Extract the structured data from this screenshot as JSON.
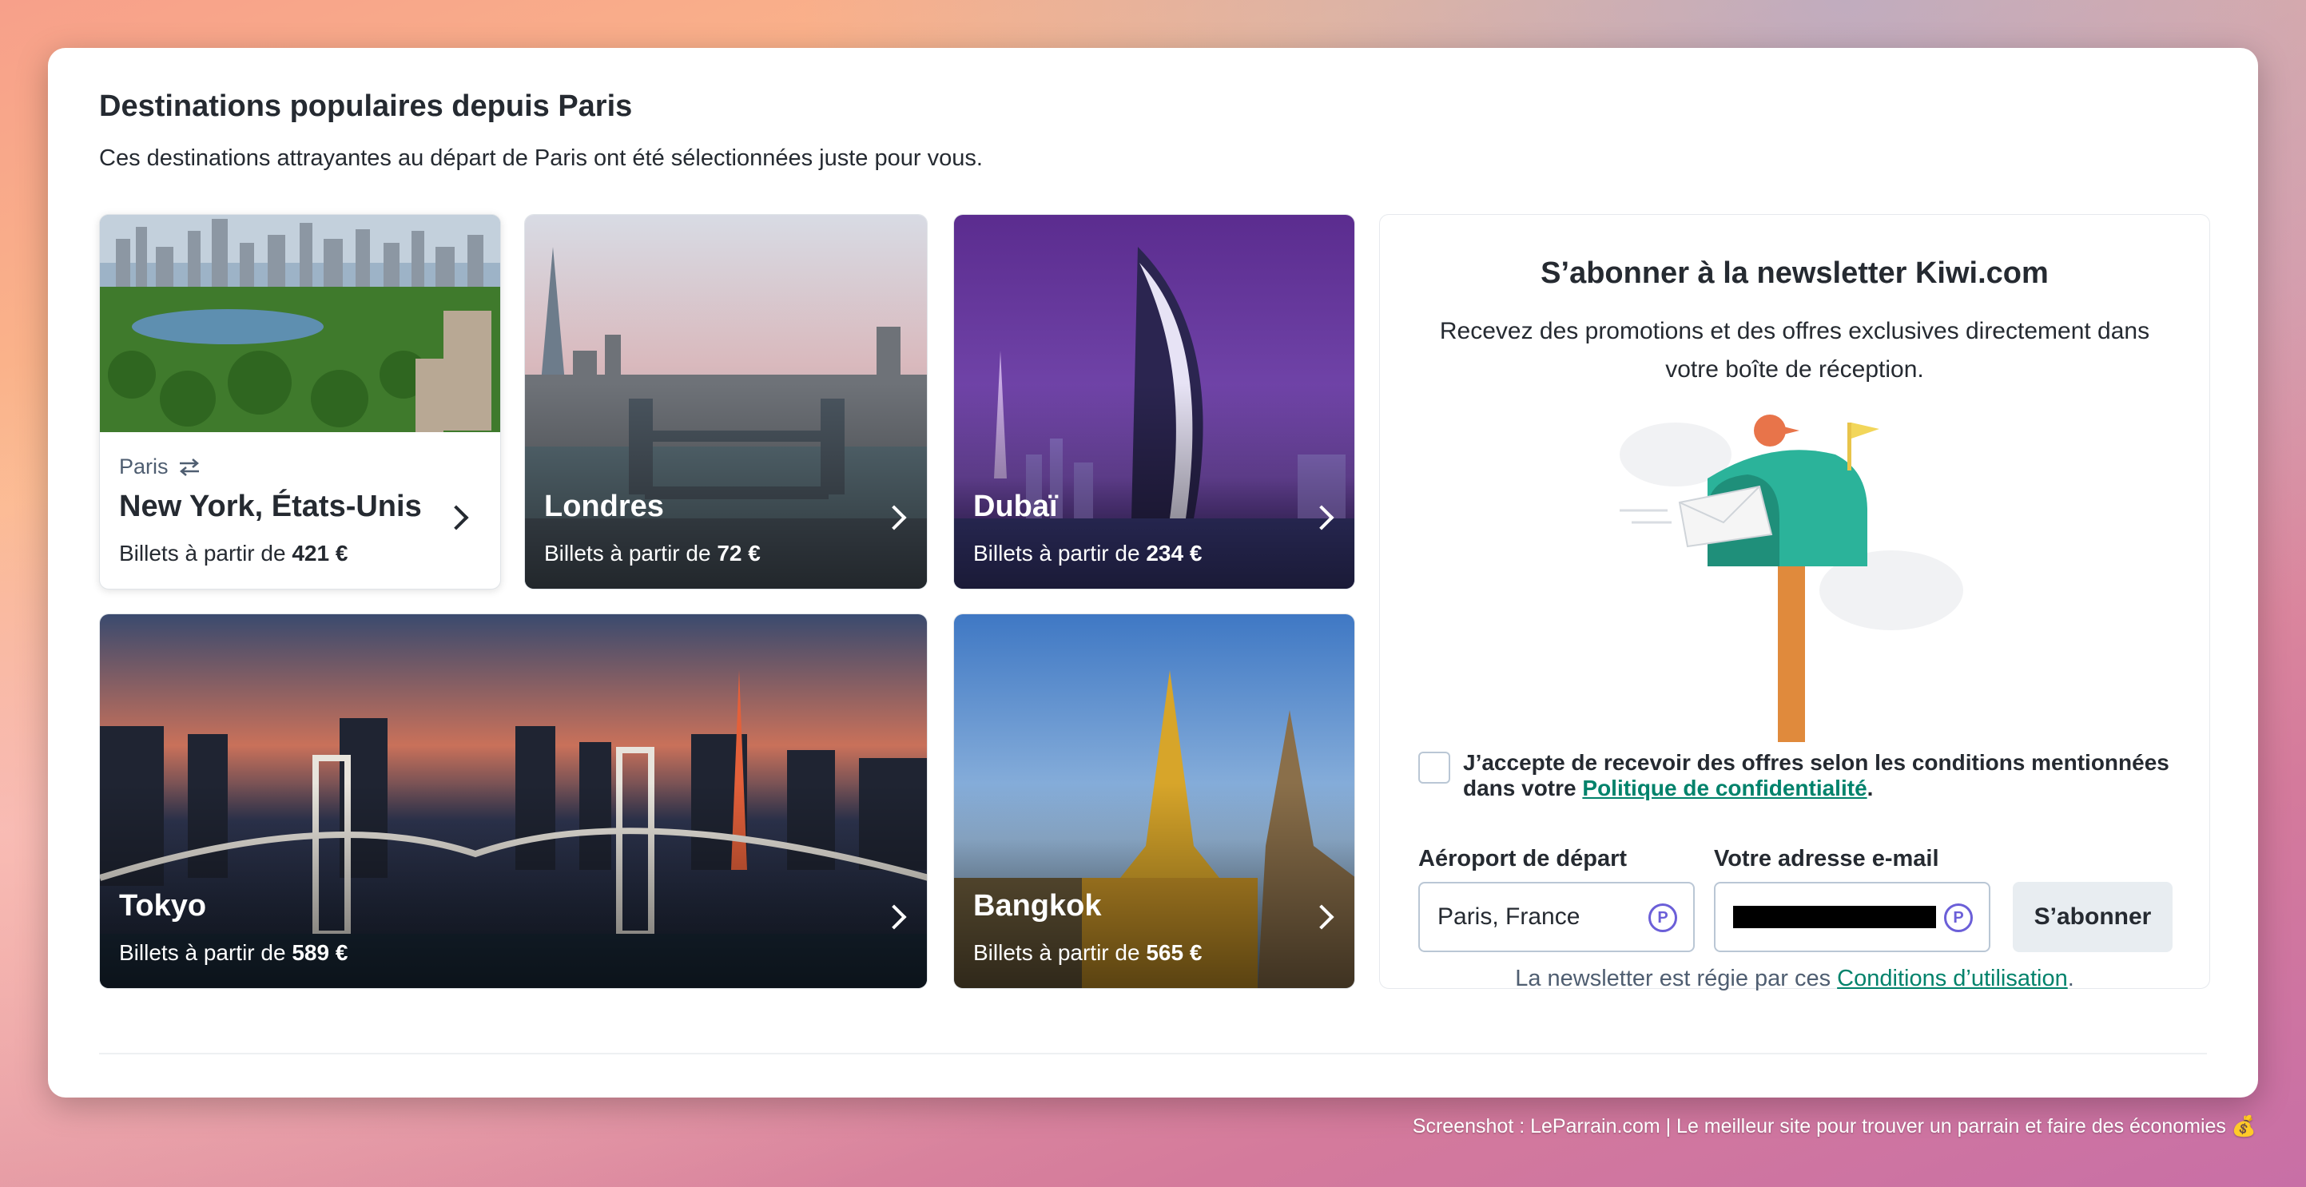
{
  "section": {
    "title": "Destinations populaires depuis Paris",
    "subtitle": "Ces destinations attrayantes au départ de Paris ont été sélectionnées juste pour vous."
  },
  "destinations": [
    {
      "origin": "Paris",
      "name": "New York, États-Unis",
      "price_prefix": "Billets à partir de ",
      "price": "421 €"
    },
    {
      "name": "Londres",
      "price_prefix": "Billets à partir de ",
      "price": "72 €"
    },
    {
      "name": "Dubaï",
      "price_prefix": "Billets à partir de ",
      "price": "234 €"
    },
    {
      "name": "Tokyo",
      "price_prefix": "Billets à partir de ",
      "price": "589 €"
    },
    {
      "name": "Bangkok",
      "price_prefix": "Billets à partir de ",
      "price": "565 €"
    }
  ],
  "newsletter": {
    "title": "S’abonner à la newsletter Kiwi.com",
    "description": "Recevez des promotions et des offres exclusives directement dans votre boîte de réception.",
    "consent_text": "J’accepte de recevoir des offres selon les conditions mentionnées dans votre ",
    "privacy_link": "Politique de confidentialité",
    "consent_end": ".",
    "airport_label": "Aéroport de départ",
    "airport_value": "Paris, France",
    "email_label": "Votre adresse e-mail",
    "subscribe_label": "S’abonner",
    "terms_text": "La newsletter est régie par ces ",
    "terms_link": "Conditions d’utilisation",
    "terms_end": "."
  },
  "footer": {
    "credit": "Screenshot : LeParrain.com | Le meilleur site pour trouver un parrain et faire des économies 💰"
  },
  "colors": {
    "link": "#00826b",
    "mailbox": "#2bb39a",
    "text": "#252a31"
  },
  "icons": {
    "swap": "swap-arrows-icon",
    "chevron": "chevron-right-icon",
    "password_manager": "password-manager-icon"
  }
}
